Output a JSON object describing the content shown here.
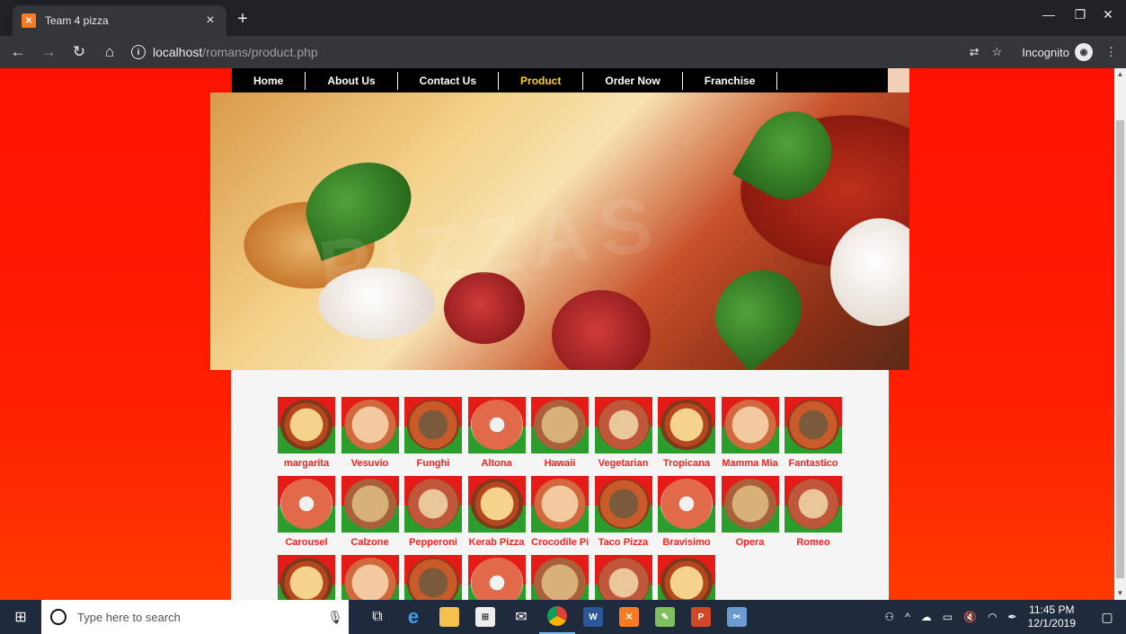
{
  "browser": {
    "tab_title": "Team 4 pizza",
    "tab_favicon": "xampp-favicon-icon",
    "url_host": "localhost",
    "url_path": "/romans/product.php",
    "incognito_label": "Incognito"
  },
  "nav": {
    "items": [
      {
        "label": "Home",
        "active": false
      },
      {
        "label": "About Us",
        "active": false
      },
      {
        "label": "Contact Us",
        "active": false
      },
      {
        "label": "Product",
        "active": true
      },
      {
        "label": "Order Now",
        "active": false
      },
      {
        "label": "Franchise",
        "active": false
      }
    ],
    "active_color": "#ffd400"
  },
  "hero": {
    "watermark": "PIZZAS"
  },
  "products": [
    {
      "name": "margarita"
    },
    {
      "name": "Vesuvio"
    },
    {
      "name": "Funghi"
    },
    {
      "name": "Altona"
    },
    {
      "name": "Hawaii"
    },
    {
      "name": "Vegetarian"
    },
    {
      "name": "Tropicana"
    },
    {
      "name": "Mamma Mia"
    },
    {
      "name": "Fantastico"
    },
    {
      "name": "Carousel"
    },
    {
      "name": "Calzone"
    },
    {
      "name": "Pepperoni"
    },
    {
      "name": "Kerab Pizza"
    },
    {
      "name": "Crocodile Pizza"
    },
    {
      "name": "Taco Pizza"
    },
    {
      "name": "Bravisimo"
    },
    {
      "name": "Opera"
    },
    {
      "name": "Romeo"
    },
    {
      "name": ""
    },
    {
      "name": ""
    },
    {
      "name": ""
    },
    {
      "name": ""
    },
    {
      "name": ""
    },
    {
      "name": ""
    },
    {
      "name": ""
    }
  ],
  "colors": {
    "page_bg": "#ff1e00",
    "label": "#ff1f1f",
    "tile_top": "#e51b18",
    "tile_bottom": "#2a9d2a"
  },
  "taskbar": {
    "search_placeholder": "Type here to search",
    "time": "11:45 PM",
    "date": "12/1/2019"
  }
}
